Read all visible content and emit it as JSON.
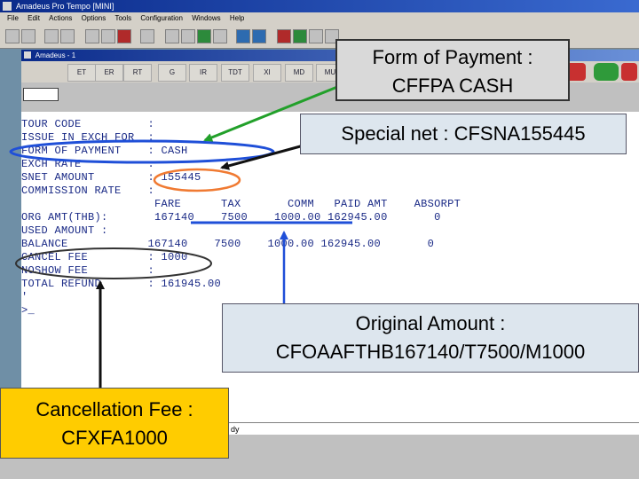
{
  "app": {
    "title": "Amadeus Pro Tempo [MINI]",
    "menu": [
      "File",
      "Edit",
      "Actions",
      "Options",
      "Tools",
      "Configuration",
      "Windows",
      "Help"
    ]
  },
  "window": {
    "title": "Amadeus - 1",
    "tabs": [
      "ET",
      "ER",
      "RT",
      "G",
      "IR",
      "TDT",
      "XI",
      "MD",
      "MU"
    ]
  },
  "terminal": {
    "lines": [
      "TOUR CODE          :",
      "ISSUE IN EXCH FOR  :",
      "FORM OF PAYMENT    : CASH",
      "EXCH RATE          :",
      "SNET AMOUNT        : 155445",
      "COMMISSION RATE    :",
      "                    FARE      TAX       COMM   PAID AMT    ABSORPT",
      "ORG AMT(THB):       167140    7500    1000.00 162945.00       0",
      "USED AMOUNT :",
      "BALANCE            167140    7500    1000.00 162945.00       0",
      "CANCEL FEE         : 1000",
      "NOSHOW FEE         :",
      "TOTAL REFUND       : 161945.00",
      "'",
      ">_"
    ]
  },
  "status": {
    "text": "dy"
  },
  "callouts": {
    "form_of_payment": {
      "line1": "Form of Payment :",
      "line2": "CFFPA CASH"
    },
    "special_net": {
      "text": "Special net : CFSNA155445"
    },
    "original_amount": {
      "line1": "Original Amount :",
      "line2": "CFOAAFTHB167140/T7500/M1000"
    },
    "cancellation_fee": {
      "line1": "Cancellation Fee :",
      "line2": "CFXFA1000"
    }
  },
  "colors": {
    "terminal_text": "#1a2a86",
    "ellipse_blue": "#1f4fd8",
    "ellipse_orange": "#f07a32",
    "ellipse_black": "#222222",
    "arrow_green": "#22a02a",
    "callout_yellow": "#ffcc00"
  }
}
